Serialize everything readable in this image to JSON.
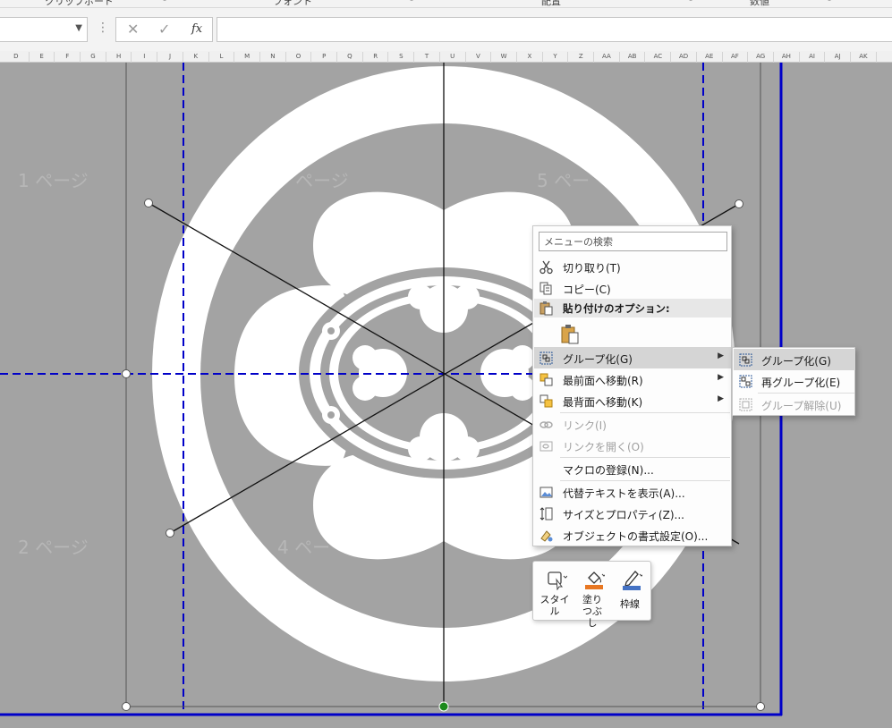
{
  "ribbon": {
    "groups": [
      "クリップボード",
      "フォント",
      "配置",
      "数値"
    ]
  },
  "formula_bar": {
    "name_box_value": "",
    "cancel_symbol": "✕",
    "enter_symbol": "✓",
    "fx_label": "fx",
    "formula_value": ""
  },
  "columns": [
    "D",
    "E",
    "F",
    "G",
    "H",
    "I",
    "J",
    "K",
    "L",
    "M",
    "N",
    "O",
    "P",
    "Q",
    "R",
    "S",
    "T",
    "U",
    "V",
    "W",
    "X",
    "Y",
    "Z",
    "AA",
    "AB",
    "AC",
    "AD",
    "AE",
    "AF",
    "AG",
    "AH",
    "AI",
    "AJ",
    "AK"
  ],
  "sheet": {
    "page_labels": [
      "1 ページ",
      "ページ",
      "5 ペー",
      "2 ページ",
      "4 ペー"
    ],
    "background_color": "#a3a3a3",
    "page_break_color": "#0000c8",
    "shape_color": "#ffffff"
  },
  "context_menu": {
    "search_placeholder": "メニューの検索",
    "items": [
      {
        "label": "切り取り(T)",
        "icon": "scissors-icon",
        "enabled": true
      },
      {
        "label": "コピー(C)",
        "icon": "copy-icon",
        "enabled": true
      },
      {
        "label": "貼り付けのオプション:",
        "icon": "paste-icon",
        "enabled": true
      },
      {
        "label": "グループ化(G)",
        "icon": "group-icon",
        "enabled": true,
        "submenu": true,
        "highlighted": true
      },
      {
        "label": "最前面へ移動(R)",
        "icon": "bring-front-icon",
        "enabled": true,
        "submenu": true
      },
      {
        "label": "最背面へ移動(K)",
        "icon": "send-back-icon",
        "enabled": true,
        "submenu": true
      },
      {
        "label": "リンク(I)",
        "icon": "link-icon",
        "enabled": false
      },
      {
        "label": "リンクを開く(O)",
        "icon": "open-link-icon",
        "enabled": false
      },
      {
        "label": "マクロの登録(N)...",
        "icon": "",
        "enabled": true
      },
      {
        "label": "代替テキストを表示(A)...",
        "icon": "alt-text-icon",
        "enabled": true
      },
      {
        "label": "サイズとプロパティ(Z)...",
        "icon": "size-properties-icon",
        "enabled": true
      },
      {
        "label": "オブジェクトの書式設定(O)...",
        "icon": "format-object-icon",
        "enabled": true
      }
    ]
  },
  "submenu": {
    "items": [
      {
        "label": "グループ化(G)",
        "icon": "group-icon",
        "enabled": true,
        "highlighted": true
      },
      {
        "label": "再グループ化(E)",
        "icon": "regroup-icon",
        "enabled": true
      },
      {
        "label": "グループ解除(U)",
        "icon": "ungroup-icon",
        "enabled": false
      }
    ]
  },
  "mini_toolbar": {
    "style_label": "スタイル",
    "fill_label": "塗りつぶし",
    "outline_label": "枠線",
    "fill_color": "#e87722",
    "outline_color": "#4472c4"
  }
}
